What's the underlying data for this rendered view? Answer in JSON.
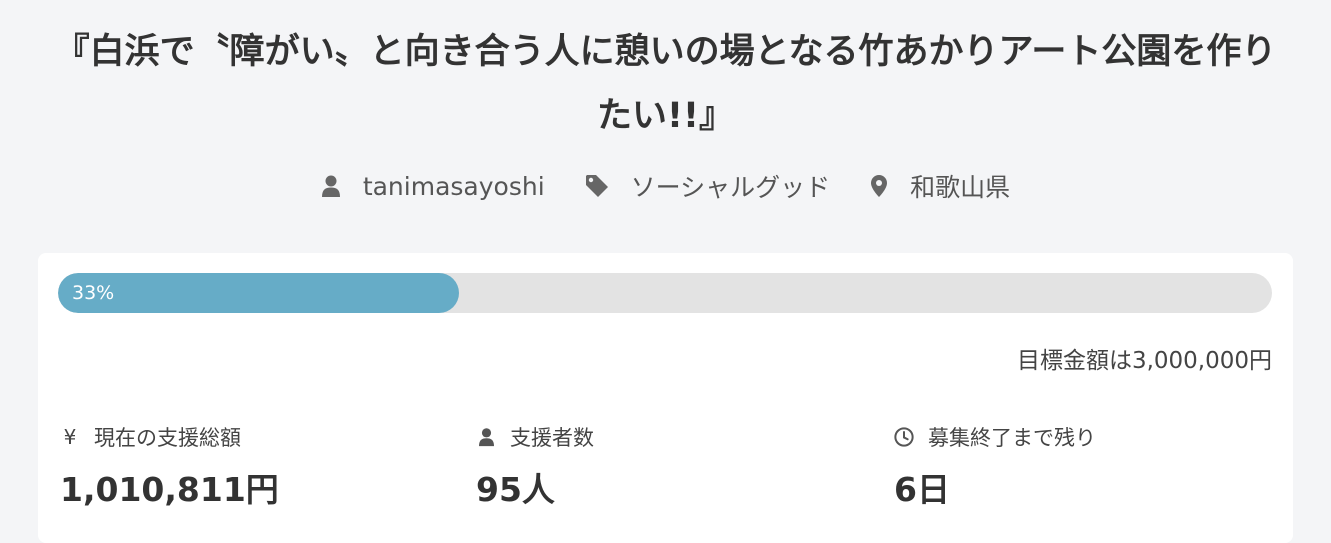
{
  "project": {
    "title": "『白浜で〝障がい〟と向き合う人に憩いの場となる竹あかりアート公園を作りたい!!』"
  },
  "meta": {
    "author": "tanimasayoshi",
    "category": "ソーシャルグッド",
    "location": "和歌山県"
  },
  "progress": {
    "percent_label": "33%",
    "fraction": 0.33
  },
  "goal": {
    "text": "目標金額は3,000,000円"
  },
  "stats": {
    "total": {
      "icon_text": "¥",
      "label": "現在の支援総額",
      "value": "1,010,811円"
    },
    "backers": {
      "label": "支援者数",
      "value": "95人"
    },
    "remaining": {
      "label": "募集終了まで残り",
      "value": "6日"
    }
  },
  "colors": {
    "accent": "#66acc7",
    "track": "#e3e3e3",
    "background": "#f4f5f7"
  },
  "icons": [
    "user-icon",
    "tag-icon",
    "location-pin-icon",
    "yen-icon",
    "user-icon",
    "clock-icon"
  ]
}
